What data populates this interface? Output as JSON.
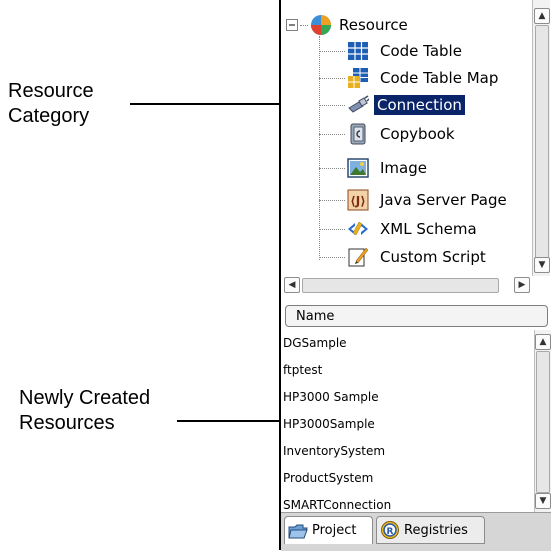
{
  "callouts": {
    "resource_category": [
      "Resource",
      "Category"
    ],
    "newly_created": [
      "Newly Created",
      "Resources"
    ]
  },
  "tree": {
    "root": {
      "label": "Resource",
      "icon": "pie-chart-icon"
    },
    "children": [
      {
        "label": "Code Table",
        "icon": "grid-table-icon"
      },
      {
        "label": "Code Table Map",
        "icon": "table-map-icon"
      },
      {
        "label": "Connection",
        "icon": "connection-plug-icon",
        "selected": true
      },
      {
        "label": "Copybook",
        "icon": "copybook-icon"
      },
      {
        "label": "Image",
        "icon": "image-icon"
      },
      {
        "label": "Java Server Page",
        "icon": "jsp-icon"
      },
      {
        "label": "XML Schema",
        "icon": "xml-schema-icon"
      },
      {
        "label": "Custom Script",
        "icon": "custom-script-icon"
      }
    ]
  },
  "list": {
    "header": "Name",
    "items": [
      "DGSample",
      "ftptest",
      "HP3000 Sample",
      "HP3000Sample",
      "InventorySystem",
      "ProductSystem",
      "SMARTConnection"
    ]
  },
  "tabs": [
    {
      "label": "Project",
      "icon": "folder-icon",
      "active": true
    },
    {
      "label": "Registries",
      "icon": "registry-icon",
      "active": false
    }
  ],
  "colors": {
    "selection": "#0a246a"
  }
}
